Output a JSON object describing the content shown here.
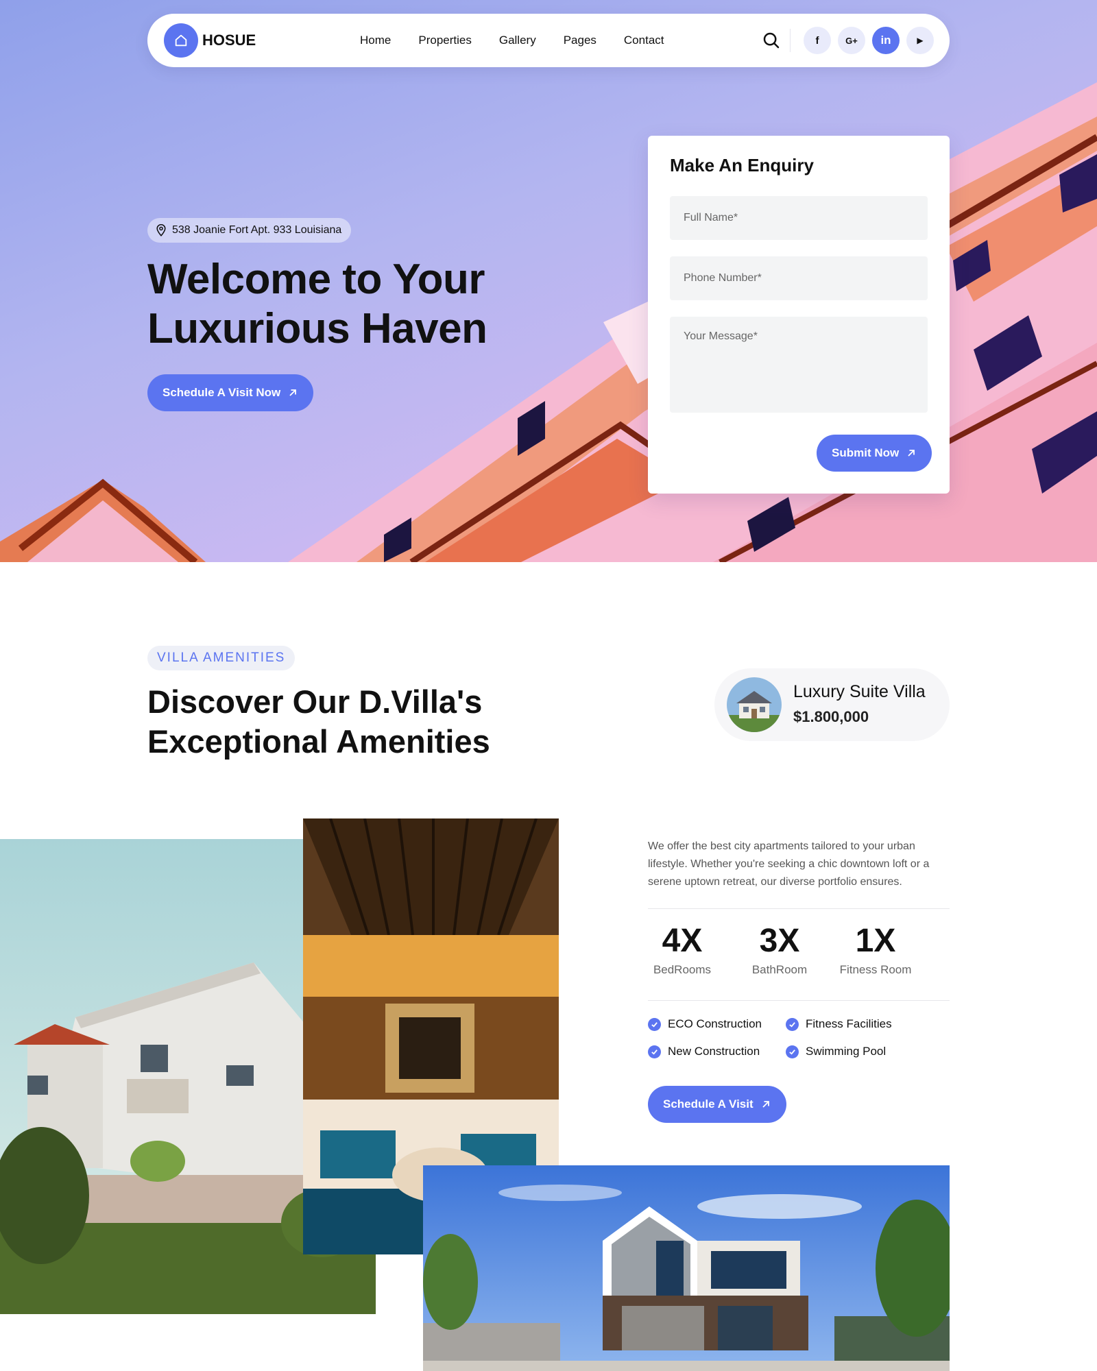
{
  "nav": {
    "brand": "HOSUE",
    "items": [
      "Home",
      "Properties",
      "Gallery",
      "Pages",
      "Contact"
    ],
    "social": [
      "f",
      "G+",
      "in",
      "▶"
    ]
  },
  "hero": {
    "address": "538 Joanie Fort Apt. 933 Louisiana",
    "title": "Welcome to Your Luxurious Haven",
    "cta": "Schedule A Visit Now"
  },
  "enquiry": {
    "title": "Make An Enquiry",
    "name_placeholder": "Full Name*",
    "phone_placeholder": "Phone Number*",
    "message_placeholder": "Your Message*",
    "submit": "Submit Now"
  },
  "amenities": {
    "tag": "VILLA AMENITIES",
    "title": "Discover Our D.Villa's Exceptional Amenities",
    "villa_card": {
      "name": "Luxury Suite Villa",
      "price": "$1.800,000"
    },
    "description": "We offer the best city apartments tailored to your urban lifestyle. Whether you're seeking a chic downtown loft or a serene uptown retreat, our diverse portfolio ensures.",
    "stats": [
      {
        "value": "4X",
        "label": "BedRooms"
      },
      {
        "value": "3X",
        "label": "BathRoom"
      },
      {
        "value": "1X",
        "label": "Fitness Room"
      }
    ],
    "features": [
      "ECO Construction",
      "Fitness Facilities",
      "New Construction",
      "Swimming Pool"
    ],
    "cta": "Schedule A Visit"
  },
  "colors": {
    "accent": "#5b74f0",
    "text": "#111111",
    "muted": "#555555",
    "hero_sky": "#b3b5f0"
  }
}
